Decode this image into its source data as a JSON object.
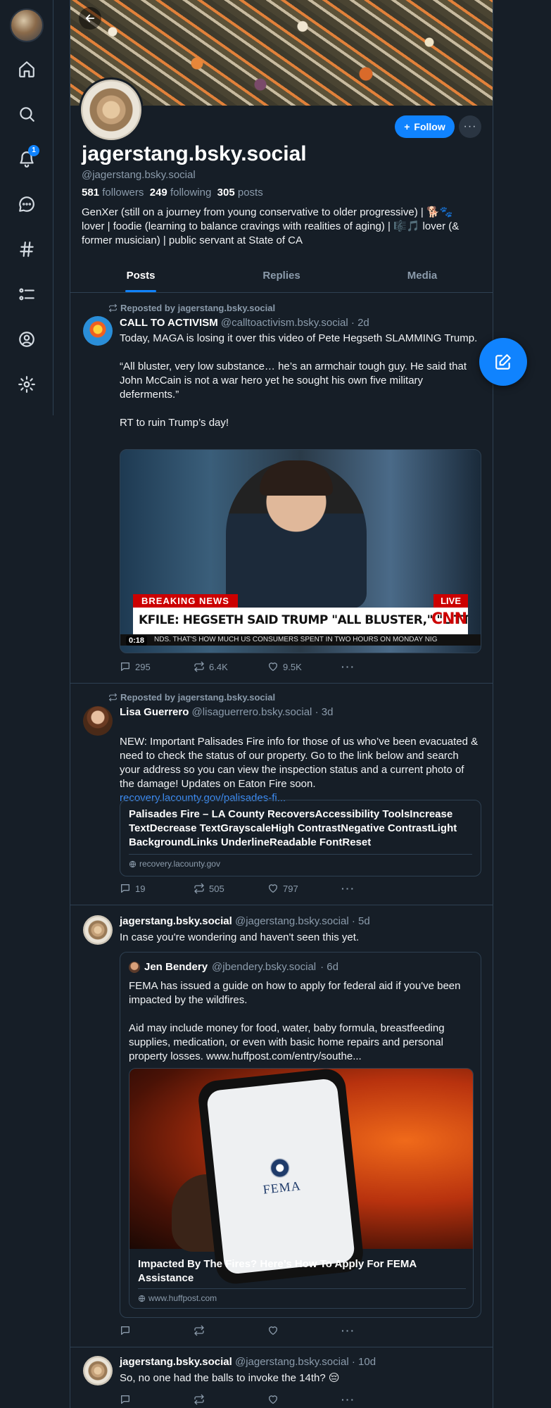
{
  "profile": {
    "display_name": "jagerstang.bsky.social",
    "handle": "@jagerstang.bsky.social",
    "followers_count": "581",
    "followers_label": "followers",
    "following_count": "249",
    "following_label": "following",
    "posts_count": "305",
    "posts_label": "posts",
    "bio": "GenXer (still on a journey from young conservative to older progressive) | 🐕🐾 lover | foodie (learning to balance cravings with realities of aging) | 🎼🎵 lover (& former musician) | public servant at State of CA",
    "follow_label": "Follow",
    "more_label": "···"
  },
  "nav": {
    "notification_count": "1"
  },
  "tabs": [
    {
      "label": "Posts",
      "active": true
    },
    {
      "label": "Replies",
      "active": false
    },
    {
      "label": "Media",
      "active": false
    }
  ],
  "posts": [
    {
      "repost_by": "Reposted by jagerstang.bsky.social",
      "author": "CALL TO ACTIVISM",
      "handle": "@calltoactivism.bsky.social",
      "time": "· 2d",
      "text": "Today, MAGA is losing it over this video of Pete Hegseth SLAMMING Trump.\n\n“All bluster, very low substance… he’s an armchair tough guy. He said that John McCain is not a war hero yet he sought his own five military deferments.”\n\nRT to ruin Trump’s day!",
      "video": {
        "breaking": "BREAKING NEWS",
        "live": "LIVE",
        "headline": "KFILE: HEGSETH SAID TRUMP \"ALL BLUSTER,\" \"LITTLE SUBSTANCE\"",
        "network": "CNN",
        "ticker": "NDS. THAT'S HOW MUCH US CONSUMERS SPENT IN TWO HOURS ON MONDAY NIG",
        "duration": "0:18"
      },
      "replies": "295",
      "reposts": "6.4K",
      "likes": "9.5K"
    },
    {
      "repost_by": "Reposted by jagerstang.bsky.social",
      "author": "Lisa Guerrero",
      "handle": "@lisaguerrero.bsky.social",
      "time": "· 3d",
      "text": "NEW: Important Palisades Fire info for those of us who’ve been evacuated & need to check the status of our property. Go to the link below and search your address so you can view the inspection status and a current photo of the damage! Updates on Eaton Fire soon.",
      "link": "recovery.lacounty.gov/palisades-fi...",
      "card_title": "Palisades Fire – LA County RecoversAccessibility ToolsIncrease TextDecrease TextGrayscaleHigh ContrastNegative ContrastLight BackgroundLinks UnderlineReadable FontReset",
      "card_domain": "recovery.lacounty.gov",
      "replies": "19",
      "reposts": "505",
      "likes": "797"
    },
    {
      "author": "jagerstang.bsky.social",
      "handle": "@jagerstang.bsky.social",
      "time": "· 5d",
      "text": "In case you're wondering and haven't seen this yet.",
      "quote": {
        "author": "Jen Bendery",
        "handle": "@jbendery.bsky.social",
        "time": "· 6d",
        "text": "FEMA has issued a guide on how to apply for federal aid if you've been impacted by the wildfires.\n\nAid may include money for food, water, baby formula, breastfeeding supplies, medication, or even with basic home repairs and personal property losses. www.huffpost.com/entry/southe...",
        "image_text": "FEMA",
        "card_title": "Impacted By The Fires? Here’s How To Apply For FEMA Assistance",
        "card_domain": "www.huffpost.com"
      }
    },
    {
      "author": "jagerstang.bsky.social",
      "handle": "@jagerstang.bsky.social",
      "time": "· 10d",
      "text": "So, no one had the balls to invoke the 14th? 😔"
    }
  ],
  "colors": {
    "background": "#161e27",
    "accent": "#1083fe",
    "muted": "#8b9bab",
    "border": "#2e4052"
  }
}
